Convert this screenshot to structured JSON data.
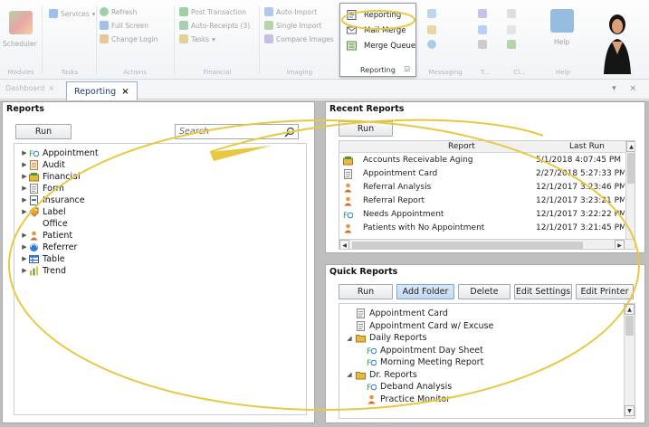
{
  "ribbon": {
    "groups": [
      {
        "id": "modules",
        "name": "Modules",
        "items": [
          "Scheduler"
        ]
      },
      {
        "id": "tasks",
        "name": "Tasks",
        "items": [
          "Services"
        ]
      },
      {
        "id": "actions",
        "name": "Actions",
        "items": [
          "Refresh",
          "Full Screen",
          "Change Login"
        ]
      },
      {
        "id": "financial",
        "name": "Financial",
        "items": [
          "Post Transaction",
          "Auto-Receipts (3)",
          "Tasks"
        ]
      },
      {
        "id": "imaging",
        "name": "Imaging",
        "items": [
          "Auto-Import",
          "Single Import",
          "Compare Images"
        ]
      },
      {
        "id": "reporting",
        "name": "Reporting",
        "items": [
          "Reporting",
          "Mail Merge",
          "Merge Queue"
        ]
      },
      {
        "id": "messaging",
        "name": "Messaging",
        "items": []
      },
      {
        "id": "t",
        "name": "T...",
        "items": []
      },
      {
        "id": "c",
        "name": "Cl...",
        "items": []
      },
      {
        "id": "help",
        "name": "Help",
        "items": [
          "Help"
        ]
      }
    ]
  },
  "tabs": {
    "dashboard": "Dashboard",
    "active": "Reporting",
    "close_glyph": "×",
    "controls": "▾ ×"
  },
  "reports_panel": {
    "title": "Reports",
    "run_label": "Run",
    "search_placeholder": "Search",
    "tree": [
      {
        "label": "Appointment",
        "icon": "appointment-icon",
        "expandable": true
      },
      {
        "label": "Audit",
        "icon": "audit-icon",
        "expandable": true
      },
      {
        "label": "Financial",
        "icon": "financial-icon",
        "expandable": true
      },
      {
        "label": "Form",
        "icon": "form-icon",
        "expandable": true
      },
      {
        "label": "Insurance",
        "icon": "insurance-icon",
        "expandable": true
      },
      {
        "label": "Label",
        "icon": "label-icon",
        "expandable": true
      },
      {
        "label": "Office",
        "icon": "",
        "expandable": false
      },
      {
        "label": "Patient",
        "icon": "patient-icon",
        "expandable": true
      },
      {
        "label": "Referrer",
        "icon": "referrer-icon",
        "expandable": true
      },
      {
        "label": "Table",
        "icon": "table-icon",
        "expandable": true
      },
      {
        "label": "Trend",
        "icon": "trend-icon",
        "expandable": true
      }
    ]
  },
  "recent_reports": {
    "title": "Recent Reports",
    "run_label": "Run",
    "columns": [
      "Report",
      "Last Run"
    ],
    "rows": [
      {
        "icon": "financial-icon",
        "report": "Accounts Receivable Aging",
        "last_run": "5/1/2018 4:07:45 PM"
      },
      {
        "icon": "form-icon",
        "report": "Appointment Card",
        "last_run": "2/27/2018 5:27:33 PM"
      },
      {
        "icon": "patient-icon",
        "report": "Referral Analysis",
        "last_run": "12/1/2017 3:23:46 PM"
      },
      {
        "icon": "patient-icon",
        "report": "Referral Report",
        "last_run": "12/1/2017 3:23:21 PM"
      },
      {
        "icon": "appointment-icon",
        "report": "Needs Appointment",
        "last_run": "12/1/2017 3:22:22 PM"
      },
      {
        "icon": "patient-icon",
        "report": "Patients with No Appointment",
        "last_run": "12/1/2017 3:21:45 PM"
      }
    ]
  },
  "quick_reports": {
    "title": "Quick Reports",
    "buttons": {
      "run": "Run",
      "add_folder": "Add Folder",
      "delete": "Delete",
      "edit_settings": "Edit Settings",
      "edit_printer": "Edit Printer"
    },
    "tree": [
      {
        "level": 1,
        "label": "Appointment Card",
        "icon": "form-icon",
        "toggle": ""
      },
      {
        "level": 1,
        "label": "Appointment Card w/ Excuse",
        "icon": "form-icon",
        "toggle": ""
      },
      {
        "level": 0,
        "label": "Daily Reports",
        "icon": "folder-icon",
        "toggle": "◢"
      },
      {
        "level": 2,
        "label": "Appointment Day Sheet",
        "icon": "appointment-icon",
        "toggle": ""
      },
      {
        "level": 2,
        "label": "Morning Meeting Report",
        "icon": "appointment-icon",
        "toggle": ""
      },
      {
        "level": 0,
        "label": "Dr. Reports",
        "icon": "folder-icon",
        "toggle": "◢"
      },
      {
        "level": 2,
        "label": "Deband Analysis",
        "icon": "appointment-icon",
        "toggle": ""
      },
      {
        "level": 2,
        "label": "Practice Monitor",
        "icon": "patient-icon",
        "toggle": ""
      }
    ]
  },
  "colors": {
    "annotation": "#e8c840",
    "accent": "#1e73be",
    "panel_bg": "#bebebe"
  }
}
